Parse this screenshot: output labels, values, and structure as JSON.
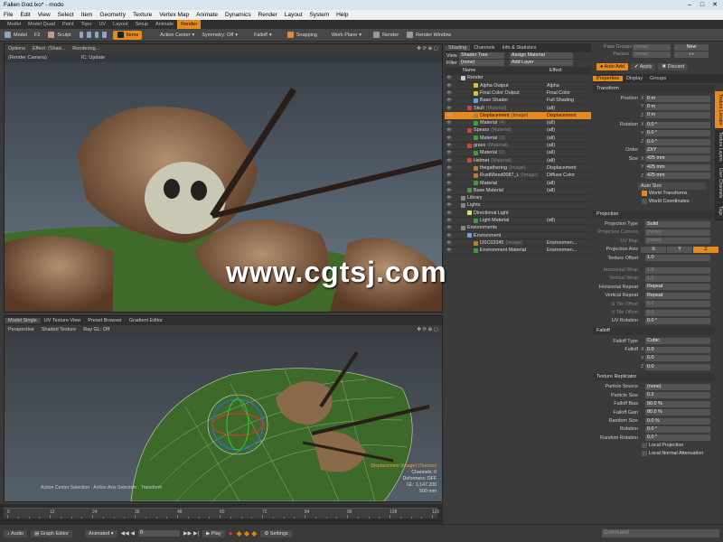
{
  "window": {
    "title": "Fallen God.lxo* - modo"
  },
  "menu": [
    "File",
    "Edit",
    "View",
    "Select",
    "Item",
    "Geometry",
    "Texture",
    "Vertex Map",
    "Animate",
    "Dynamics",
    "Render",
    "Layout",
    "System",
    "Help"
  ],
  "tabs": [
    {
      "label": "Model",
      "active": false
    },
    {
      "label": "Model Quad",
      "active": false
    },
    {
      "label": "Paint",
      "active": false
    },
    {
      "label": "Topo",
      "active": false
    },
    {
      "label": "UV",
      "active": false
    },
    {
      "label": "Layout",
      "active": false
    },
    {
      "label": "Setup",
      "active": false
    },
    {
      "label": "Animate",
      "active": false
    },
    {
      "label": "Render",
      "active": true
    }
  ],
  "toolbar": {
    "model": "Model",
    "f2": "F2",
    "sculpt": "Sculpt",
    "items": "Items",
    "action_center": "Action Center",
    "symmetry": "Symmetry: Off",
    "falloff": "Falloff",
    "snapping": "Snapping",
    "work_plane": "Work Plane",
    "render": "Render",
    "render_window": "Render Window"
  },
  "render_view": {
    "options": "Options",
    "effect": "Effect: (Shad...",
    "status": "Rendering...",
    "camera": "(Render Camera)",
    "ic": "IC: Update"
  },
  "bottom_view": {
    "tabs": [
      "Model Single",
      "UV Texture View",
      "Preset Browser",
      "Gradient Editor"
    ],
    "perspective": "Perspective",
    "shading": "Shaded Texture",
    "raygl": "Ray GL: Off",
    "info_title": "Displacement (Image) (Texture)",
    "info_lines": [
      "Channels: 0",
      "Deformers: OFF",
      "GL: 1,147,200",
      "500 mm"
    ],
    "selection": "Action Center Selection : Action Axis Selection : Transform"
  },
  "shader": {
    "tabs": [
      "Shading",
      "Channels",
      "Info & Statistics"
    ],
    "view_label": "View",
    "view_value": "Shader Tree",
    "assign": "Assign Material",
    "filter_label": "Filter",
    "filter_value": "(none)",
    "add_layer": "Add Layer",
    "col_name": "Name",
    "col_effect": "Effect",
    "rows": [
      {
        "name": "Render",
        "effect": "",
        "indent": 0,
        "color": "#c8c8c8"
      },
      {
        "name": "Alpha Output",
        "effect": "Alpha",
        "indent": 2,
        "color": "#e0c040"
      },
      {
        "name": "Final Color Output",
        "effect": "Final Color",
        "indent": 2,
        "color": "#e0c040"
      },
      {
        "name": "Base Shader",
        "effect": "Full Shading",
        "indent": 2,
        "color": "#6aa0e0"
      },
      {
        "name": "Skull",
        "tag": "(Material)",
        "effect": "(all)",
        "indent": 1,
        "color": "#d04040"
      },
      {
        "name": "Displacement",
        "tag": "(Image)",
        "effect": "Displacement",
        "indent": 2,
        "color": "#b08040",
        "selected": true
      },
      {
        "name": "Material",
        "tag": "(4)",
        "effect": "(all)",
        "indent": 2,
        "color": "#40a040"
      },
      {
        "name": "Spears",
        "tag": "(Material)",
        "effect": "(all)",
        "indent": 1,
        "color": "#d04040"
      },
      {
        "name": "Material",
        "tag": "(3)",
        "effect": "(all)",
        "indent": 2,
        "color": "#40a040"
      },
      {
        "name": "grass",
        "tag": "(Material)",
        "effect": "(all)",
        "indent": 1,
        "color": "#d04040"
      },
      {
        "name": "Material",
        "tag": "(2)",
        "effect": "(all)",
        "indent": 2,
        "color": "#40a040"
      },
      {
        "name": "Helmet",
        "tag": "(Material)",
        "effect": "(all)",
        "indent": 1,
        "color": "#d04040"
      },
      {
        "name": "thegathering",
        "tag": "(Image)",
        "effect": "Displacement",
        "indent": 2,
        "color": "#b08040"
      },
      {
        "name": "RustMixed0087_L",
        "tag": "(Image)",
        "effect": "Diffuse Color",
        "indent": 2,
        "color": "#b08040"
      },
      {
        "name": "Material",
        "tag": "",
        "effect": "(all)",
        "indent": 2,
        "color": "#40a040"
      },
      {
        "name": "Base Material",
        "tag": "",
        "effect": "(all)",
        "indent": 1,
        "color": "#40a040"
      },
      {
        "name": "Library",
        "tag": "",
        "effect": "",
        "indent": 0,
        "color": "#888"
      },
      {
        "name": "Lights",
        "tag": "",
        "effect": "",
        "indent": 0,
        "color": "#888"
      },
      {
        "name": "Directional Light",
        "tag": "",
        "effect": "",
        "indent": 1,
        "color": "#e0e060"
      },
      {
        "name": "Light Material",
        "tag": "",
        "effect": "(all)",
        "indent": 2,
        "color": "#40a040"
      },
      {
        "name": "Environments",
        "tag": "",
        "effect": "",
        "indent": 0,
        "color": "#888"
      },
      {
        "name": "Environment",
        "tag": "",
        "effect": "",
        "indent": 1,
        "color": "#6aa0e0"
      },
      {
        "name": "DSC02045",
        "tag": "(Image)",
        "effect": "Environmen...",
        "indent": 2,
        "color": "#b08040"
      },
      {
        "name": "Environment Material",
        "tag": "",
        "effect": "Environmen...",
        "indent": 2,
        "color": "#40a040"
      }
    ]
  },
  "props_top": {
    "pass_groups": "Pass Groups",
    "pass_groups_val": "(none)",
    "new": "New",
    "passes": "Passes",
    "passes_val": "(none)",
    "auto_add": "Auto Add",
    "apply": "Apply",
    "discard": "Discard",
    "tabs": [
      "Properties",
      "Display",
      "Groups"
    ]
  },
  "transform": {
    "title": "Transform",
    "position_label": "Position",
    "position": [
      "0 m",
      "0 m",
      "0 m"
    ],
    "rotation_label": "Rotation",
    "rotation": [
      "0.0 °",
      "0.0 °",
      "0.0 °"
    ],
    "order_label": "Order",
    "order": "ZXY",
    "size_label": "Size",
    "size": [
      "425 mm",
      "425 mm",
      "425 mm"
    ],
    "auto_size": "Auto Size",
    "world_transforms": "World Transforms",
    "world_coordinates": "World Coordinates"
  },
  "projection": {
    "title": "Projection",
    "type_label": "Projection Type",
    "type": "Solid",
    "camera_label": "Projection Camera",
    "camera": "(none)",
    "uvmap_label": "UV Map",
    "uvmap": "(none)",
    "axis_label": "Projection Axis",
    "axis": [
      "X",
      "Y",
      "Z"
    ],
    "offset_label": "Texture Offset",
    "offset": "1.0",
    "hwrap_label": "Horizontal Wrap",
    "hwrap": "1.0",
    "vwrap_label": "Vertical Wrap",
    "vwrap": "1.0",
    "hrepeat_label": "Horizontal Repeat",
    "hrepeat": "Repeat",
    "vrepeat_label": "Vertical Repeat",
    "vrepeat": "Repeat",
    "utile_label": "U Tile Offset",
    "utile": "0.0",
    "vtile_label": "V Tile Offset",
    "vtile": "0.0",
    "uvrot_label": "UV Rotation",
    "uvrot": "0.0 °"
  },
  "falloff": {
    "title": "Falloff",
    "type_label": "Falloff Type",
    "type": "Cubic",
    "label": "Falloff",
    "values": [
      "0.0",
      "0.0",
      "0.0"
    ]
  },
  "replicator": {
    "title": "Texture Replicator",
    "source_label": "Particle Source",
    "source": "(none)",
    "psize_label": "Particle Size",
    "psize": "0.2",
    "fbias_label": "Falloff Bias",
    "fbias": "50.0 %",
    "fgain_label": "Falloff Gain",
    "fgain": "80.0 %",
    "rsize_label": "Random Size",
    "rsize": "0.0 %",
    "rot_label": "Rotation",
    "rot": "0.0 °",
    "rrot_label": "Random Rotation",
    "rrot": "0.0 °",
    "local_proj": "Local Projection",
    "local_norm": "Local Normal Attenuation"
  },
  "side_tabs": [
    "Texture Locator",
    "Texture Layers",
    "User Channels",
    "Tags"
  ],
  "timeline": {
    "ticks": [
      "0",
      "12",
      "24",
      "36",
      "48",
      "60",
      "72",
      "84",
      "96",
      "108",
      "120"
    ],
    "start": "0",
    "end": "120"
  },
  "statusbar": {
    "audio": "Audio",
    "graph_editor": "Graph Editor",
    "animated": "Animated",
    "frame": "0",
    "play": "Play",
    "settings": "Settings",
    "command": "Command"
  },
  "watermark": "www.cgtsj.com"
}
